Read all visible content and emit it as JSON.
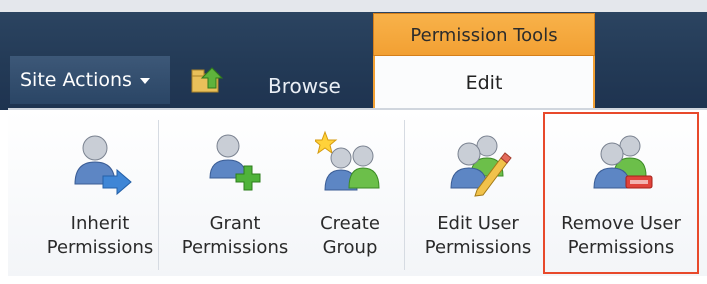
{
  "top_bar": {
    "site_actions_label": "Site Actions",
    "browse_tab_label": "Browse",
    "context_group_label": "Permission Tools",
    "edit_tab_label": "Edit"
  },
  "ribbon": {
    "buttons": [
      {
        "line1": "Inherit",
        "line2": "Permissions",
        "icon": "user-arrow-icon"
      },
      {
        "line1": "Grant",
        "line2": "Permissions",
        "icon": "user-add-icon"
      },
      {
        "line1": "Create",
        "line2": "Group",
        "icon": "group-create-icon"
      },
      {
        "line1": "Edit User",
        "line2": "Permissions",
        "icon": "users-edit-icon"
      },
      {
        "line1": "Remove User",
        "line2": "Permissions",
        "icon": "users-remove-icon"
      }
    ]
  },
  "colors": {
    "context_tab": "#f2a033",
    "highlight": "#e8492b",
    "header_dark": "#243b57"
  }
}
